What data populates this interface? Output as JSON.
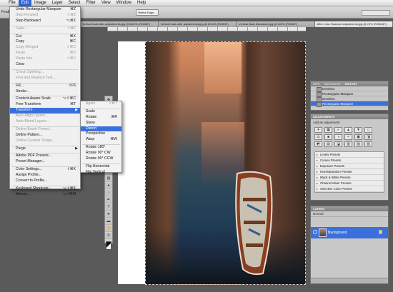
{
  "menubar": {
    "items": [
      "",
      "File",
      "Edit",
      "Image",
      "Layer",
      "Select",
      "Filter",
      "View",
      "Window",
      "Help"
    ]
  },
  "options_bar": {
    "feather_label": "Feathe",
    "refine_edge_label": "Refine Edge..."
  },
  "tabs": [
    "Vertical boat after adjustments.jpg @ 83.6% (RGB/8*)",
    "Vertical boat after adjustments.jpg @ 83.6% (RGB/8*)",
    "Vertical Boat Saturation.jpg @ 100% (RGB/8*)",
    "After Color Balance adjustments.jpg @ 21% (RGB/16*)"
  ],
  "edit_menu": [
    {
      "label": "Undo Rectangular Marquee",
      "shortcut": "⌘Z"
    },
    {
      "label": "Step Forward",
      "shortcut": "⇧⌘Z",
      "disabled": true
    },
    {
      "label": "Step Backward",
      "shortcut": "⌥⌘Z"
    },
    {
      "sep": true
    },
    {
      "label": "Fade...",
      "shortcut": "⇧⌘F",
      "disabled": true
    },
    {
      "sep": true
    },
    {
      "label": "Cut",
      "shortcut": "⌘X"
    },
    {
      "label": "Copy",
      "shortcut": "⌘C"
    },
    {
      "label": "Copy Merged",
      "shortcut": "⇧⌘C",
      "disabled": true
    },
    {
      "label": "Paste",
      "shortcut": "⌘V",
      "disabled": true
    },
    {
      "label": "Paste Into",
      "shortcut": "⇧⌘V",
      "disabled": true
    },
    {
      "label": "Clear"
    },
    {
      "sep": true
    },
    {
      "label": "Check Spelling...",
      "disabled": true
    },
    {
      "label": "Find and Replace Text...",
      "disabled": true
    },
    {
      "sep": true
    },
    {
      "label": "Fill...",
      "shortcut": "⇧F5"
    },
    {
      "label": "Stroke..."
    },
    {
      "sep": true
    },
    {
      "label": "Content-Aware Scale",
      "shortcut": "⌥⇧⌘C"
    },
    {
      "label": "Free Transform",
      "shortcut": "⌘T"
    },
    {
      "label": "Transform",
      "submenu": true,
      "highlight": true
    },
    {
      "label": "Auto-Align Layers...",
      "disabled": true
    },
    {
      "label": "Auto-Blend Layers...",
      "disabled": true
    },
    {
      "sep": true
    },
    {
      "label": "Define Brush Preset...",
      "disabled": true
    },
    {
      "label": "Define Pattern..."
    },
    {
      "label": "Define Custom Shape...",
      "disabled": true
    },
    {
      "sep": true
    },
    {
      "label": "Purge",
      "submenu": true
    },
    {
      "sep": true
    },
    {
      "label": "Adobe PDF Presets..."
    },
    {
      "label": "Preset Manager..."
    },
    {
      "sep": true
    },
    {
      "label": "Color Settings...",
      "shortcut": "⇧⌘K"
    },
    {
      "label": "Assign Profile..."
    },
    {
      "label": "Convert to Profile..."
    },
    {
      "sep": true
    },
    {
      "label": "Keyboard Shortcuts...",
      "shortcut": "⌥⇧⌘K"
    },
    {
      "label": "Menus...",
      "shortcut": "⌥⇧⌘M"
    }
  ],
  "transform_submenu": [
    {
      "label": "Again",
      "shortcut": "⇧⌘T",
      "disabled": true
    },
    {
      "sep": true
    },
    {
      "label": "Scale"
    },
    {
      "label": "Rotate",
      "shortcut": "⌘R"
    },
    {
      "label": "Skew"
    },
    {
      "label": "Distort",
      "highlight": true
    },
    {
      "label": "Perspective"
    },
    {
      "label": "Warp",
      "shortcut": "⌘W"
    },
    {
      "sep": true
    },
    {
      "label": "Rotate 180°"
    },
    {
      "label": "Rotate 90° CW"
    },
    {
      "label": "Rotate 90° CCW"
    },
    {
      "sep": true
    },
    {
      "label": "Flip Horizontal"
    },
    {
      "label": "Flip Vertical"
    }
  ],
  "history_panel": {
    "tabs": [
      "INFO",
      "NAVIGATOR",
      "HISTORY"
    ],
    "active_tab": "HISTORY",
    "items": [
      {
        "label": "Deselect"
      },
      {
        "label": "Rectangular Marquee"
      },
      {
        "label": "Deselect"
      },
      {
        "label": "Rectangular Marquee",
        "selected": true
      }
    ]
  },
  "adjustments_panel": {
    "title": "ADJUSTMENTS",
    "add_label": "Add an adjustment",
    "icons": [
      "☀",
      "▦",
      "◐",
      "▲",
      "▼",
      "◇",
      "⚖",
      "■",
      "◑",
      "◓",
      "▣",
      "◨",
      "◩",
      "▤",
      "◪",
      "▥",
      "▧",
      "▨"
    ],
    "presets": [
      "Levels Presets",
      "Curves Presets",
      "Exposure Presets",
      "Hue/Saturation Presets",
      "Black & White Presets",
      "Channel Mixer Presets",
      "Selective Color Presets"
    ]
  },
  "layers_panel": {
    "title": "LAYERS",
    "blend_mode": "Normal",
    "layer_name": "Background"
  }
}
